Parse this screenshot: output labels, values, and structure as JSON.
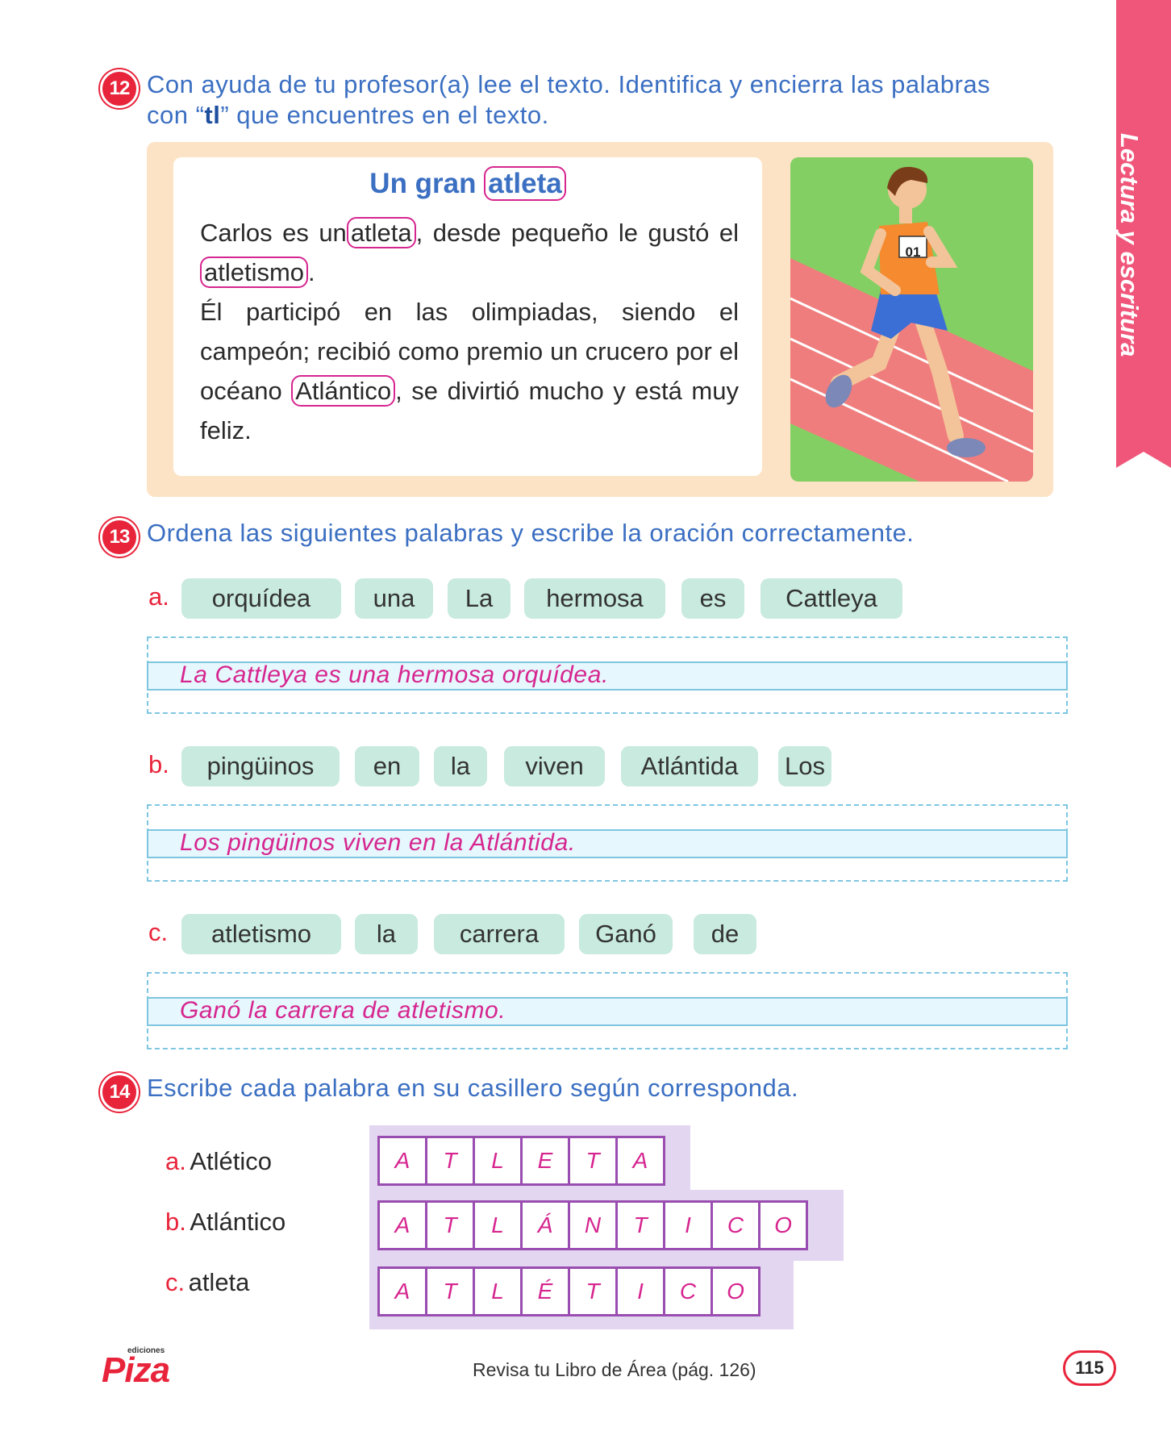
{
  "side_tab": "Lectura y escritura",
  "ex12": {
    "number": "12",
    "instruction_a": "Con ayuda de tu profesor(a) lee el texto. Identifica y encierra las palabras",
    "instruction_b_pre": "con “",
    "instruction_b_bold": "tl",
    "instruction_b_post": "” que encuentres en el texto.",
    "title_pre": "Un gran",
    "title_word": "atleta",
    "p1_pre": "Carlos es un",
    "p1_word": "atleta",
    "p1_post": ", desde pequeño le gustó el",
    "p1_word2": "atletismo",
    "p1_end": ".",
    "p2_pre": "Él participó en las olimpiadas, siendo el campeón; recibió como premio un crucero por el océano",
    "p2_word": "Atlántico",
    "p2_post": ", se divirtió mucho y está muy feliz.",
    "bib_number": "01"
  },
  "ex13": {
    "number": "13",
    "instruction": "Ordena las siguientes palabras y escribe la oración correctamente.",
    "items": [
      {
        "letter": "a.",
        "words": [
          "orquídea",
          "una",
          "La",
          "hermosa",
          "es",
          "Cattleya"
        ],
        "answer": "La Cattleya es una hermosa orquídea."
      },
      {
        "letter": "b.",
        "words": [
          "pingüinos",
          "en",
          "la",
          "viven",
          "Atlántida",
          "Los"
        ],
        "answer": "Los pingüinos viven en la Atlántida."
      },
      {
        "letter": "c.",
        "words": [
          "atletismo",
          "la",
          "carrera",
          "Ganó",
          "de"
        ],
        "answer": "Ganó la carrera de atletismo."
      }
    ]
  },
  "ex14": {
    "number": "14",
    "instruction": "Escribe cada palabra en su casillero según corresponda.",
    "options": [
      {
        "letter": "a.",
        "word": "Atlético"
      },
      {
        "letter": "b.",
        "word": "Atlántico"
      },
      {
        "letter": "c.",
        "word": "atleta"
      }
    ],
    "grids": [
      [
        "A",
        "T",
        "L",
        "E",
        "T",
        "A"
      ],
      [
        "A",
        "T",
        "L",
        "Á",
        "N",
        "T",
        "I",
        "C",
        "O"
      ],
      [
        "A",
        "T",
        "L",
        "É",
        "T",
        "I",
        "C",
        "O"
      ]
    ]
  },
  "footer": {
    "publisher_small": "ediciones",
    "publisher": "Piza",
    "note": "Revisa tu Libro de Área (pág. 126)",
    "page": "115"
  },
  "colors": {
    "accent_red": "#e8243b",
    "accent_blue": "#3b6fc2",
    "magenta": "#d6258f",
    "chip_green": "#c8eadf",
    "grid_purple": "#9a4db0"
  }
}
